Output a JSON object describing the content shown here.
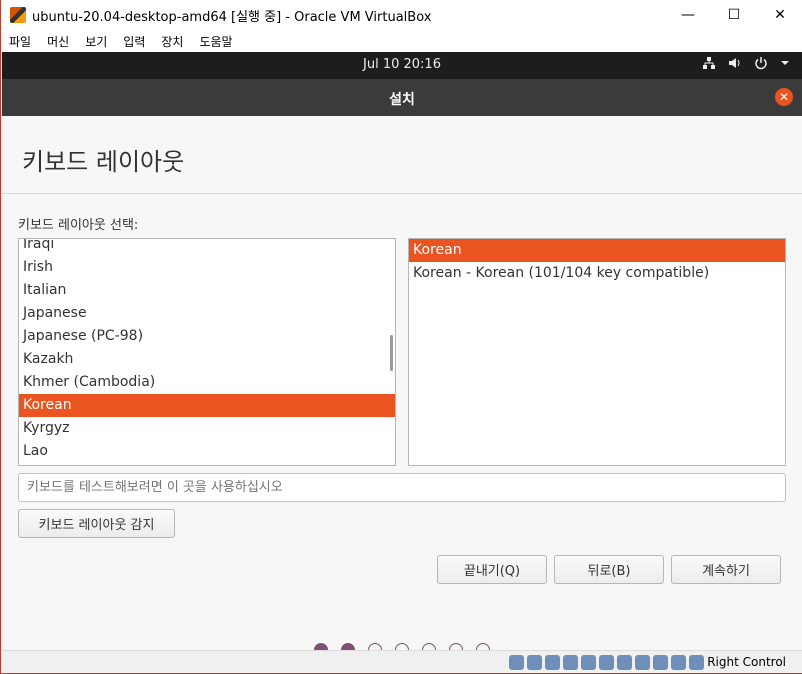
{
  "window": {
    "title": "ubuntu-20.04-desktop-amd64 [실행 중] - Oracle VM VirtualBox",
    "minimize": "—",
    "maximize": "☐",
    "close": "✕"
  },
  "menu": [
    "파일",
    "머신",
    "보기",
    "입력",
    "장치",
    "도움말"
  ],
  "topbar": {
    "clock": "Jul 10  20:16"
  },
  "header": {
    "title": "설치",
    "close": "✕"
  },
  "page": {
    "title": "키보드 레이아웃",
    "select_label": "키보드 레이아웃 선택:",
    "layouts": [
      "Iraqi",
      "Irish",
      "Italian",
      "Japanese",
      "Japanese (PC-98)",
      "Kazakh",
      "Khmer (Cambodia)",
      "Korean",
      "Kyrgyz",
      "Lao"
    ],
    "selected_layout": "Korean",
    "variants": [
      "Korean",
      "Korean - Korean (101/104 key compatible)"
    ],
    "selected_variant": "Korean",
    "test_placeholder": "키보드를 테스트해보려면 이 곳을 사용하십시오",
    "detect_button": "키보드 레이아웃 감지"
  },
  "buttons": {
    "quit": "끝내기(Q)",
    "back": "뒤로(B)",
    "continue": "계속하기"
  },
  "progress": {
    "total_steps": 7,
    "completed_steps": 2
  },
  "statusbar": {
    "host_key": "Right Control"
  },
  "colors": {
    "accent": "#e95420",
    "progress_dot": "#7e5277"
  }
}
